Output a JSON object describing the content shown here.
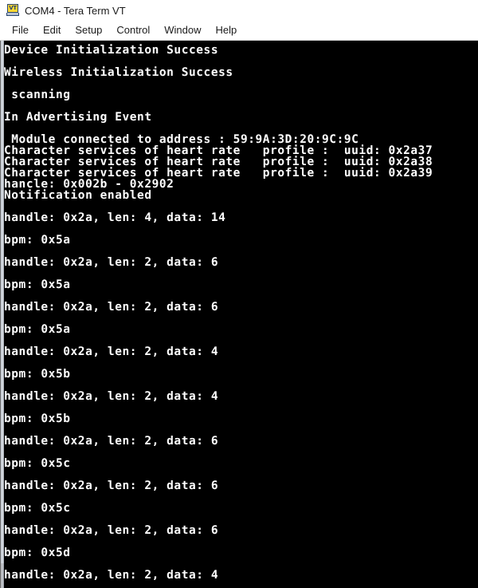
{
  "window": {
    "title": "COM4 - Tera Term VT",
    "icon_name": "tera-term-vt-icon",
    "icon_label": "VT"
  },
  "menubar": {
    "items": [
      {
        "label": "File"
      },
      {
        "label": "Edit"
      },
      {
        "label": "Setup"
      },
      {
        "label": "Control"
      },
      {
        "label": "Window"
      },
      {
        "label": "Help"
      }
    ]
  },
  "terminal": {
    "background_color": "#000000",
    "foreground_color": "#ffffff",
    "lines": [
      "Device Initialization Success",
      "",
      "Wireless Initialization Success",
      "",
      " scanning",
      "",
      "In Advertising Event",
      "",
      " Module connected to address : 59:9A:3D:20:9C:9C",
      "Character services of heart rate   profile :  uuid: 0x2a37",
      "Character services of heart rate   profile :  uuid: 0x2a38",
      "Character services of heart rate   profile :  uuid: 0x2a39",
      "hancle: 0x002b - 0x2902",
      "Notification enabled",
      "",
      "handle: 0x2a, len: 4, data: 14",
      "",
      "bpm: 0x5a",
      "",
      "handle: 0x2a, len: 2, data: 6",
      "",
      "bpm: 0x5a",
      "",
      "handle: 0x2a, len: 2, data: 6",
      "",
      "bpm: 0x5a",
      "",
      "handle: 0x2a, len: 2, data: 4",
      "",
      "bpm: 0x5b",
      "",
      "handle: 0x2a, len: 2, data: 4",
      "",
      "bpm: 0x5b",
      "",
      "handle: 0x2a, len: 2, data: 6",
      "",
      "bpm: 0x5c",
      "",
      "handle: 0x2a, len: 2, data: 6",
      "",
      "bpm: 0x5c",
      "",
      "handle: 0x2a, len: 2, data: 6",
      "",
      "bpm: 0x5d",
      "",
      "handle: 0x2a, len: 2, data: 4"
    ]
  }
}
